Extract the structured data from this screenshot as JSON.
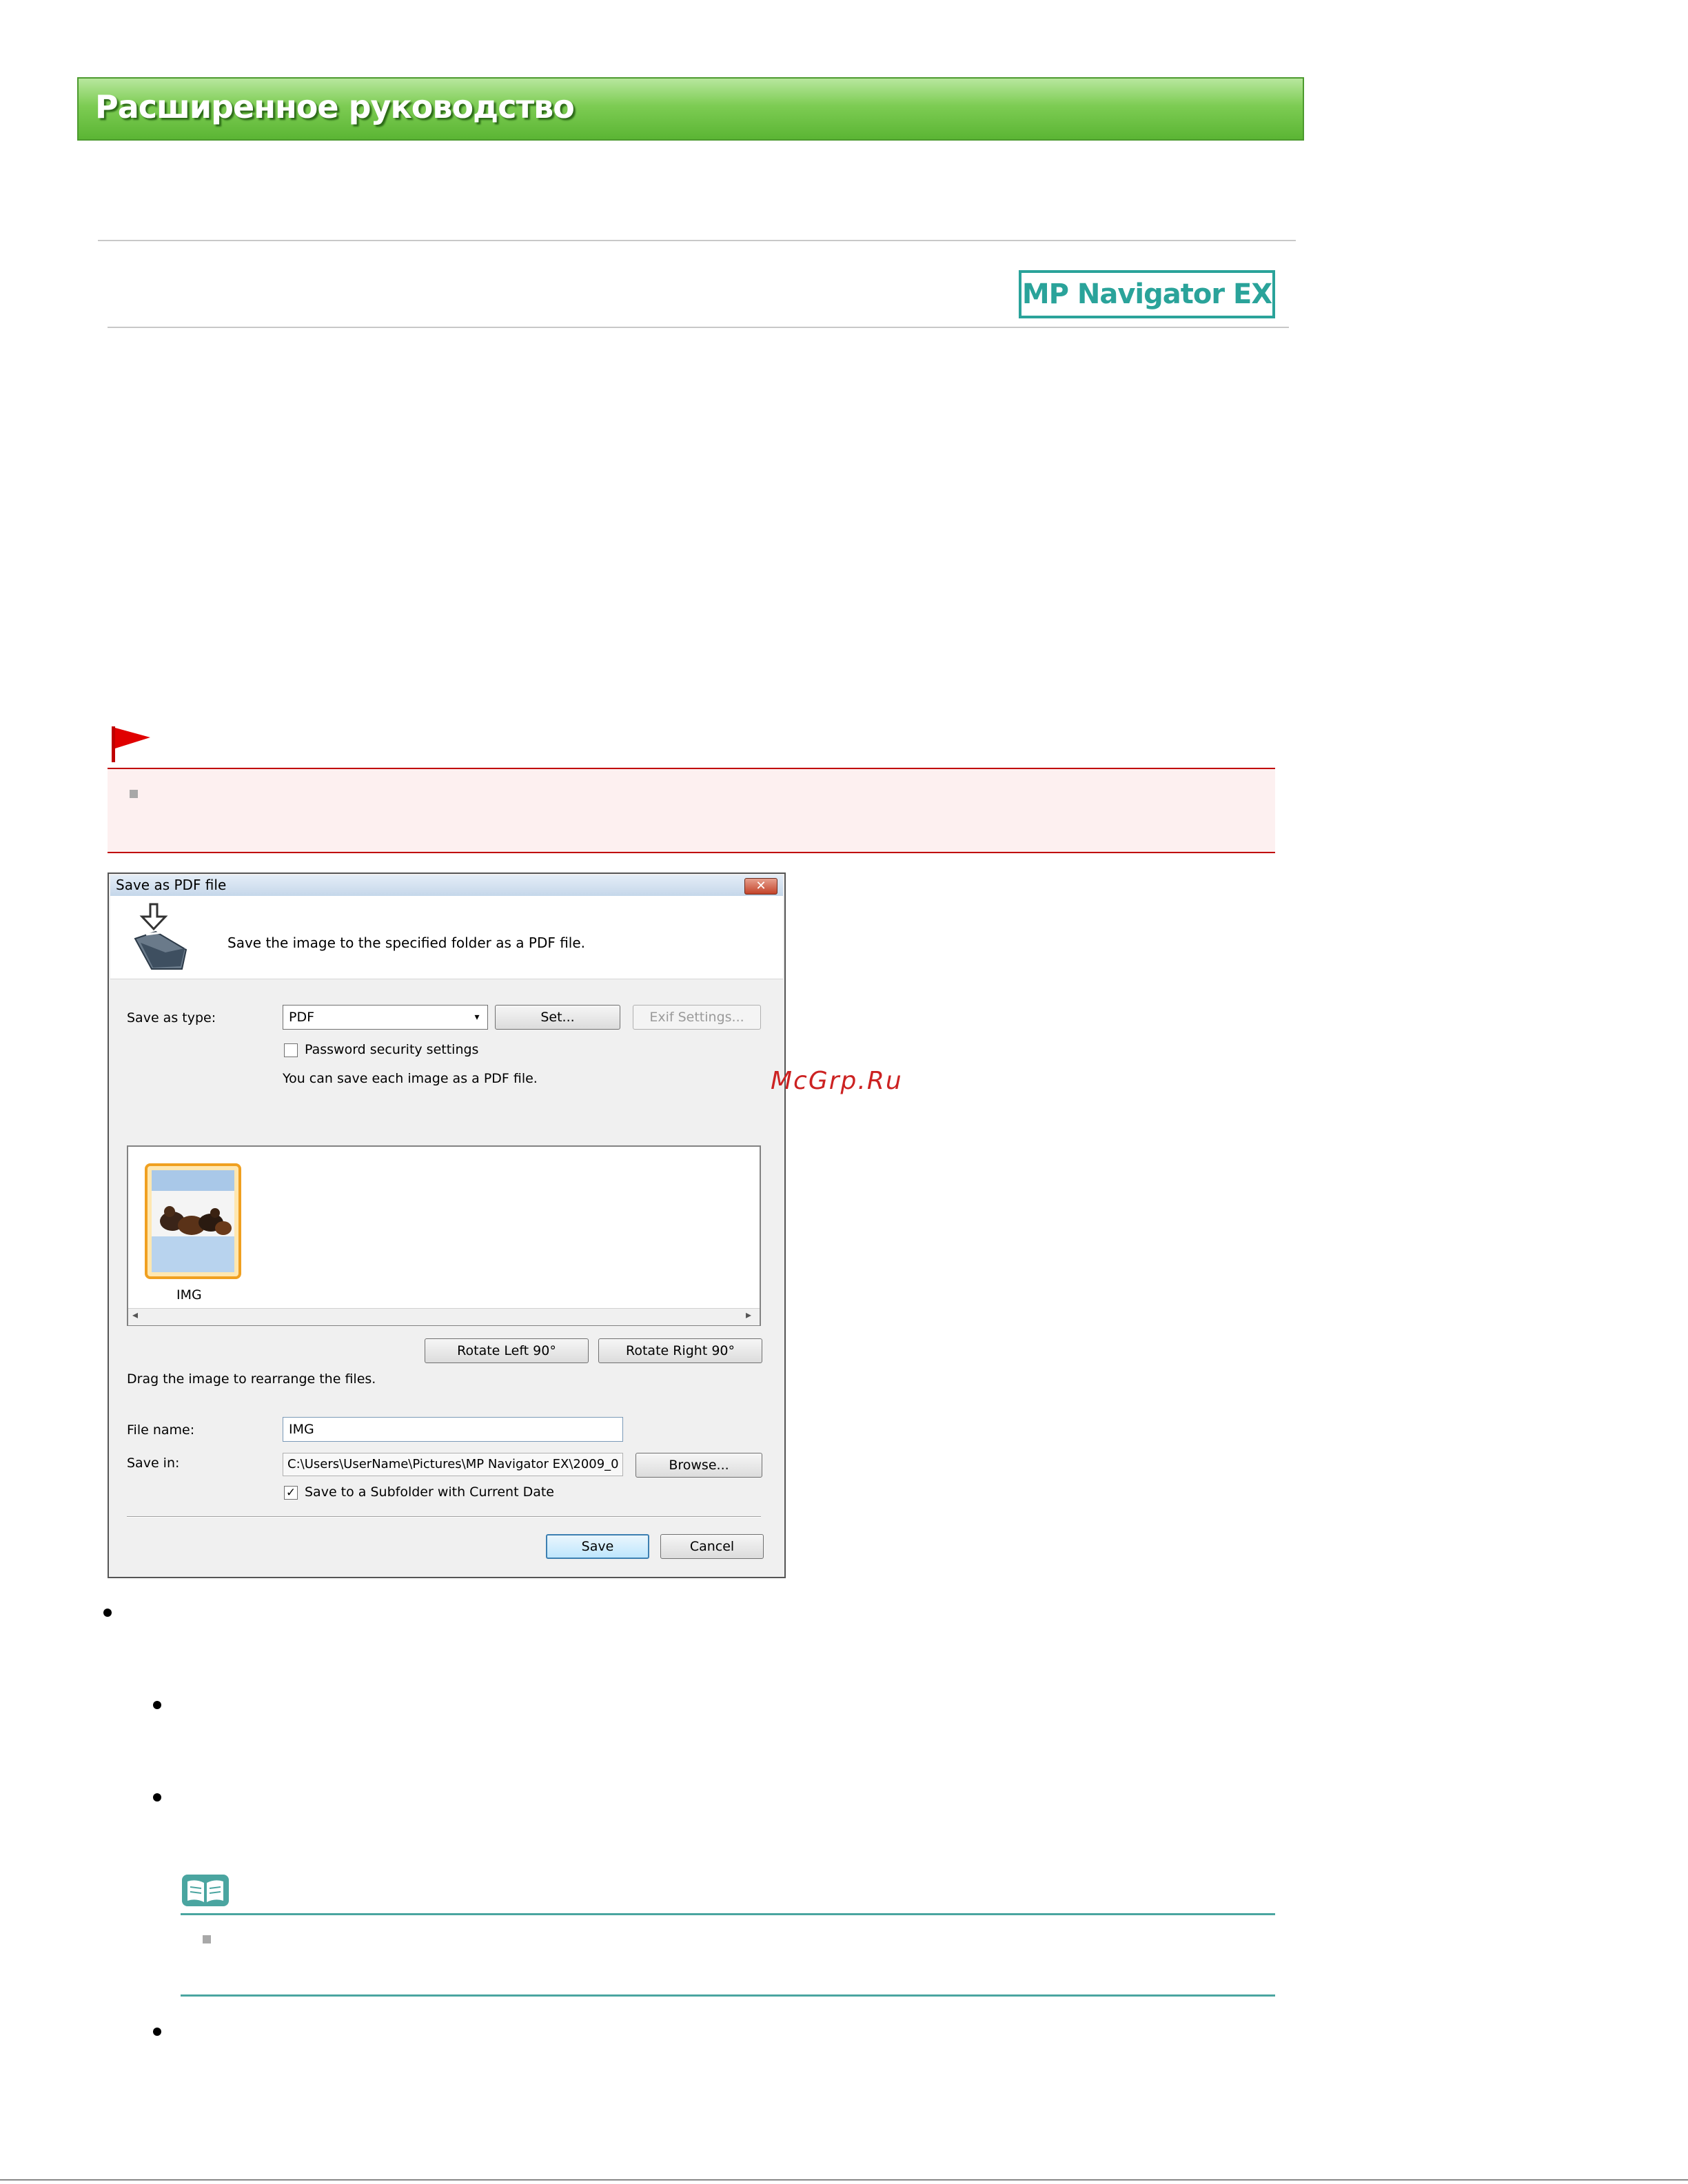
{
  "header": {
    "title": "Расширенное руководство"
  },
  "product_logo": {
    "text": "MP Navigator EX"
  },
  "dialog": {
    "title": "Save as PDF file",
    "close_symbol": "✕",
    "description": "Save the image to the specified folder as a PDF file.",
    "save_as_type_label": "Save as  type:",
    "save_as_type_value": "PDF",
    "select_arrow": "▾",
    "set_button": "Set...",
    "exif_button": "Exif Settings...",
    "password_label": "Password security settings",
    "pdf_info": "You can save each image as a PDF file.",
    "thumbnail_caption": "IMG",
    "scroll_left": "◂",
    "scroll_right": "▸",
    "rotate_left_button": "Rotate Left 90°",
    "rotate_right_button": "Rotate Right 90°",
    "drag_hint": "Drag the image to rearrange the files.",
    "file_name_label": "File name:",
    "file_name_value": "IMG",
    "save_in_label": "Save in:",
    "save_in_value": "C:\\Users\\UserName\\Pictures\\MP Navigator EX\\2009_0",
    "browse_button": "Browse...",
    "subfolder_checked": "✓",
    "subfolder_label": "Save to a Subfolder with Current Date",
    "save_button": "Save",
    "cancel_button": "Cancel"
  },
  "watermark": "McGrp.Ru",
  "colors": {
    "header_green": "#5bb534",
    "logo_teal": "#2aa39a",
    "important_red": "#c00000",
    "note_teal": "#4aa5a0",
    "thumbnail_border": "#f0a020"
  },
  "icons": {
    "flag": "red-flag-icon",
    "folder": "folder-arrow-icon",
    "note": "open-book-icon"
  }
}
